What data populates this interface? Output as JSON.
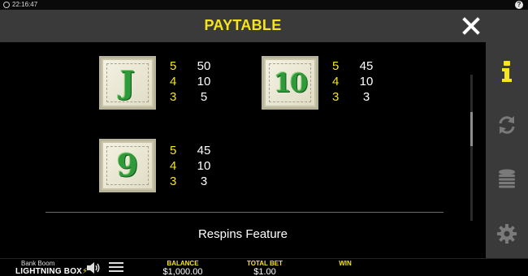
{
  "status_bar": {
    "clock": "22:16:47",
    "help_symbol": "?"
  },
  "header": {
    "title": "PAYTABLE",
    "close_icon": "close-icon"
  },
  "sidebar": {
    "buttons": [
      {
        "icon": "info-icon",
        "active": true
      },
      {
        "icon": "autoplay-icon",
        "active": false
      },
      {
        "icon": "coin-stack-icon",
        "active": false
      },
      {
        "icon": "settings-icon",
        "active": false
      }
    ]
  },
  "paytable": {
    "symbols": [
      {
        "symbol": "J",
        "pays": [
          {
            "count": "5",
            "amount": "50"
          },
          {
            "count": "4",
            "amount": "10"
          },
          {
            "count": "3",
            "amount": "5"
          }
        ]
      },
      {
        "symbol": "10",
        "pays": [
          {
            "count": "5",
            "amount": "45"
          },
          {
            "count": "4",
            "amount": "10"
          },
          {
            "count": "3",
            "amount": "3"
          }
        ]
      },
      {
        "symbol": "9",
        "pays": [
          {
            "count": "5",
            "amount": "45"
          },
          {
            "count": "4",
            "amount": "10"
          },
          {
            "count": "3",
            "amount": "3"
          }
        ]
      }
    ],
    "section_title": "Respins Feature"
  },
  "footer": {
    "game_name": "Bank Boom",
    "brand": "LIGHTNING BOX",
    "balance_label": "BALANCE",
    "balance_value": "$1,000.00",
    "total_bet_label": "TOTAL BET",
    "total_bet_value": "$1.00",
    "win_label": "WIN",
    "win_value": ""
  },
  "colors": {
    "accent": "#f5e41e",
    "panel": "#3a3a3a",
    "symbol_green": "#2f9a3a"
  }
}
